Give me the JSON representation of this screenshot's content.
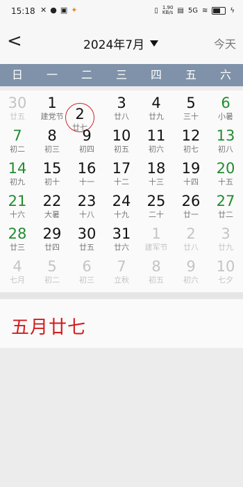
{
  "status": {
    "time": "15:18",
    "left_icons": [
      "tools-icon",
      "chat-icon",
      "app-icon",
      "running-icon"
    ],
    "net_speed_value": "1.90",
    "net_speed_unit": "KB/s",
    "network": "5G"
  },
  "header": {
    "back_label": "<",
    "title": "2024年7月",
    "today_label": "今天"
  },
  "weekdays": [
    "日",
    "一",
    "二",
    "三",
    "四",
    "五",
    "六"
  ],
  "weeks": [
    [
      {
        "d": "30",
        "s": "廿五",
        "out": true
      },
      {
        "d": "1",
        "s": "建党节"
      },
      {
        "d": "2",
        "s": "廿七",
        "today": true
      },
      {
        "d": "3",
        "s": "廿八"
      },
      {
        "d": "4",
        "s": "廿九"
      },
      {
        "d": "5",
        "s": "三十"
      },
      {
        "d": "6",
        "s": "小暑"
      }
    ],
    [
      {
        "d": "7",
        "s": "初二"
      },
      {
        "d": "8",
        "s": "初三"
      },
      {
        "d": "9",
        "s": "初四"
      },
      {
        "d": "10",
        "s": "初五"
      },
      {
        "d": "11",
        "s": "初六"
      },
      {
        "d": "12",
        "s": "初七"
      },
      {
        "d": "13",
        "s": "初八"
      }
    ],
    [
      {
        "d": "14",
        "s": "初九"
      },
      {
        "d": "15",
        "s": "初十"
      },
      {
        "d": "16",
        "s": "十一"
      },
      {
        "d": "17",
        "s": "十二"
      },
      {
        "d": "18",
        "s": "十三"
      },
      {
        "d": "19",
        "s": "十四"
      },
      {
        "d": "20",
        "s": "十五"
      }
    ],
    [
      {
        "d": "21",
        "s": "十六"
      },
      {
        "d": "22",
        "s": "大暑"
      },
      {
        "d": "23",
        "s": "十八"
      },
      {
        "d": "24",
        "s": "十九"
      },
      {
        "d": "25",
        "s": "二十"
      },
      {
        "d": "26",
        "s": "廿一"
      },
      {
        "d": "27",
        "s": "廿二"
      }
    ],
    [
      {
        "d": "28",
        "s": "廿三"
      },
      {
        "d": "29",
        "s": "廿四"
      },
      {
        "d": "30",
        "s": "廿五"
      },
      {
        "d": "31",
        "s": "廿六"
      },
      {
        "d": "1",
        "s": "建军节",
        "out": true
      },
      {
        "d": "2",
        "s": "廿八",
        "out": true
      },
      {
        "d": "3",
        "s": "廿九",
        "out": true
      }
    ],
    [
      {
        "d": "4",
        "s": "七月",
        "out": true
      },
      {
        "d": "5",
        "s": "初二",
        "out": true
      },
      {
        "d": "6",
        "s": "初三",
        "out": true
      },
      {
        "d": "7",
        "s": "立秋",
        "out": true
      },
      {
        "d": "8",
        "s": "初五",
        "out": true
      },
      {
        "d": "9",
        "s": "初六",
        "out": true
      },
      {
        "d": "10",
        "s": "七夕",
        "out": true
      }
    ]
  ],
  "selected_lunar": "五月廿七",
  "colors": {
    "weekbar": "#7f92a9",
    "weekend": "#218c2f",
    "lunar_text": "#d31b1b",
    "today_ring": "#d32424"
  }
}
